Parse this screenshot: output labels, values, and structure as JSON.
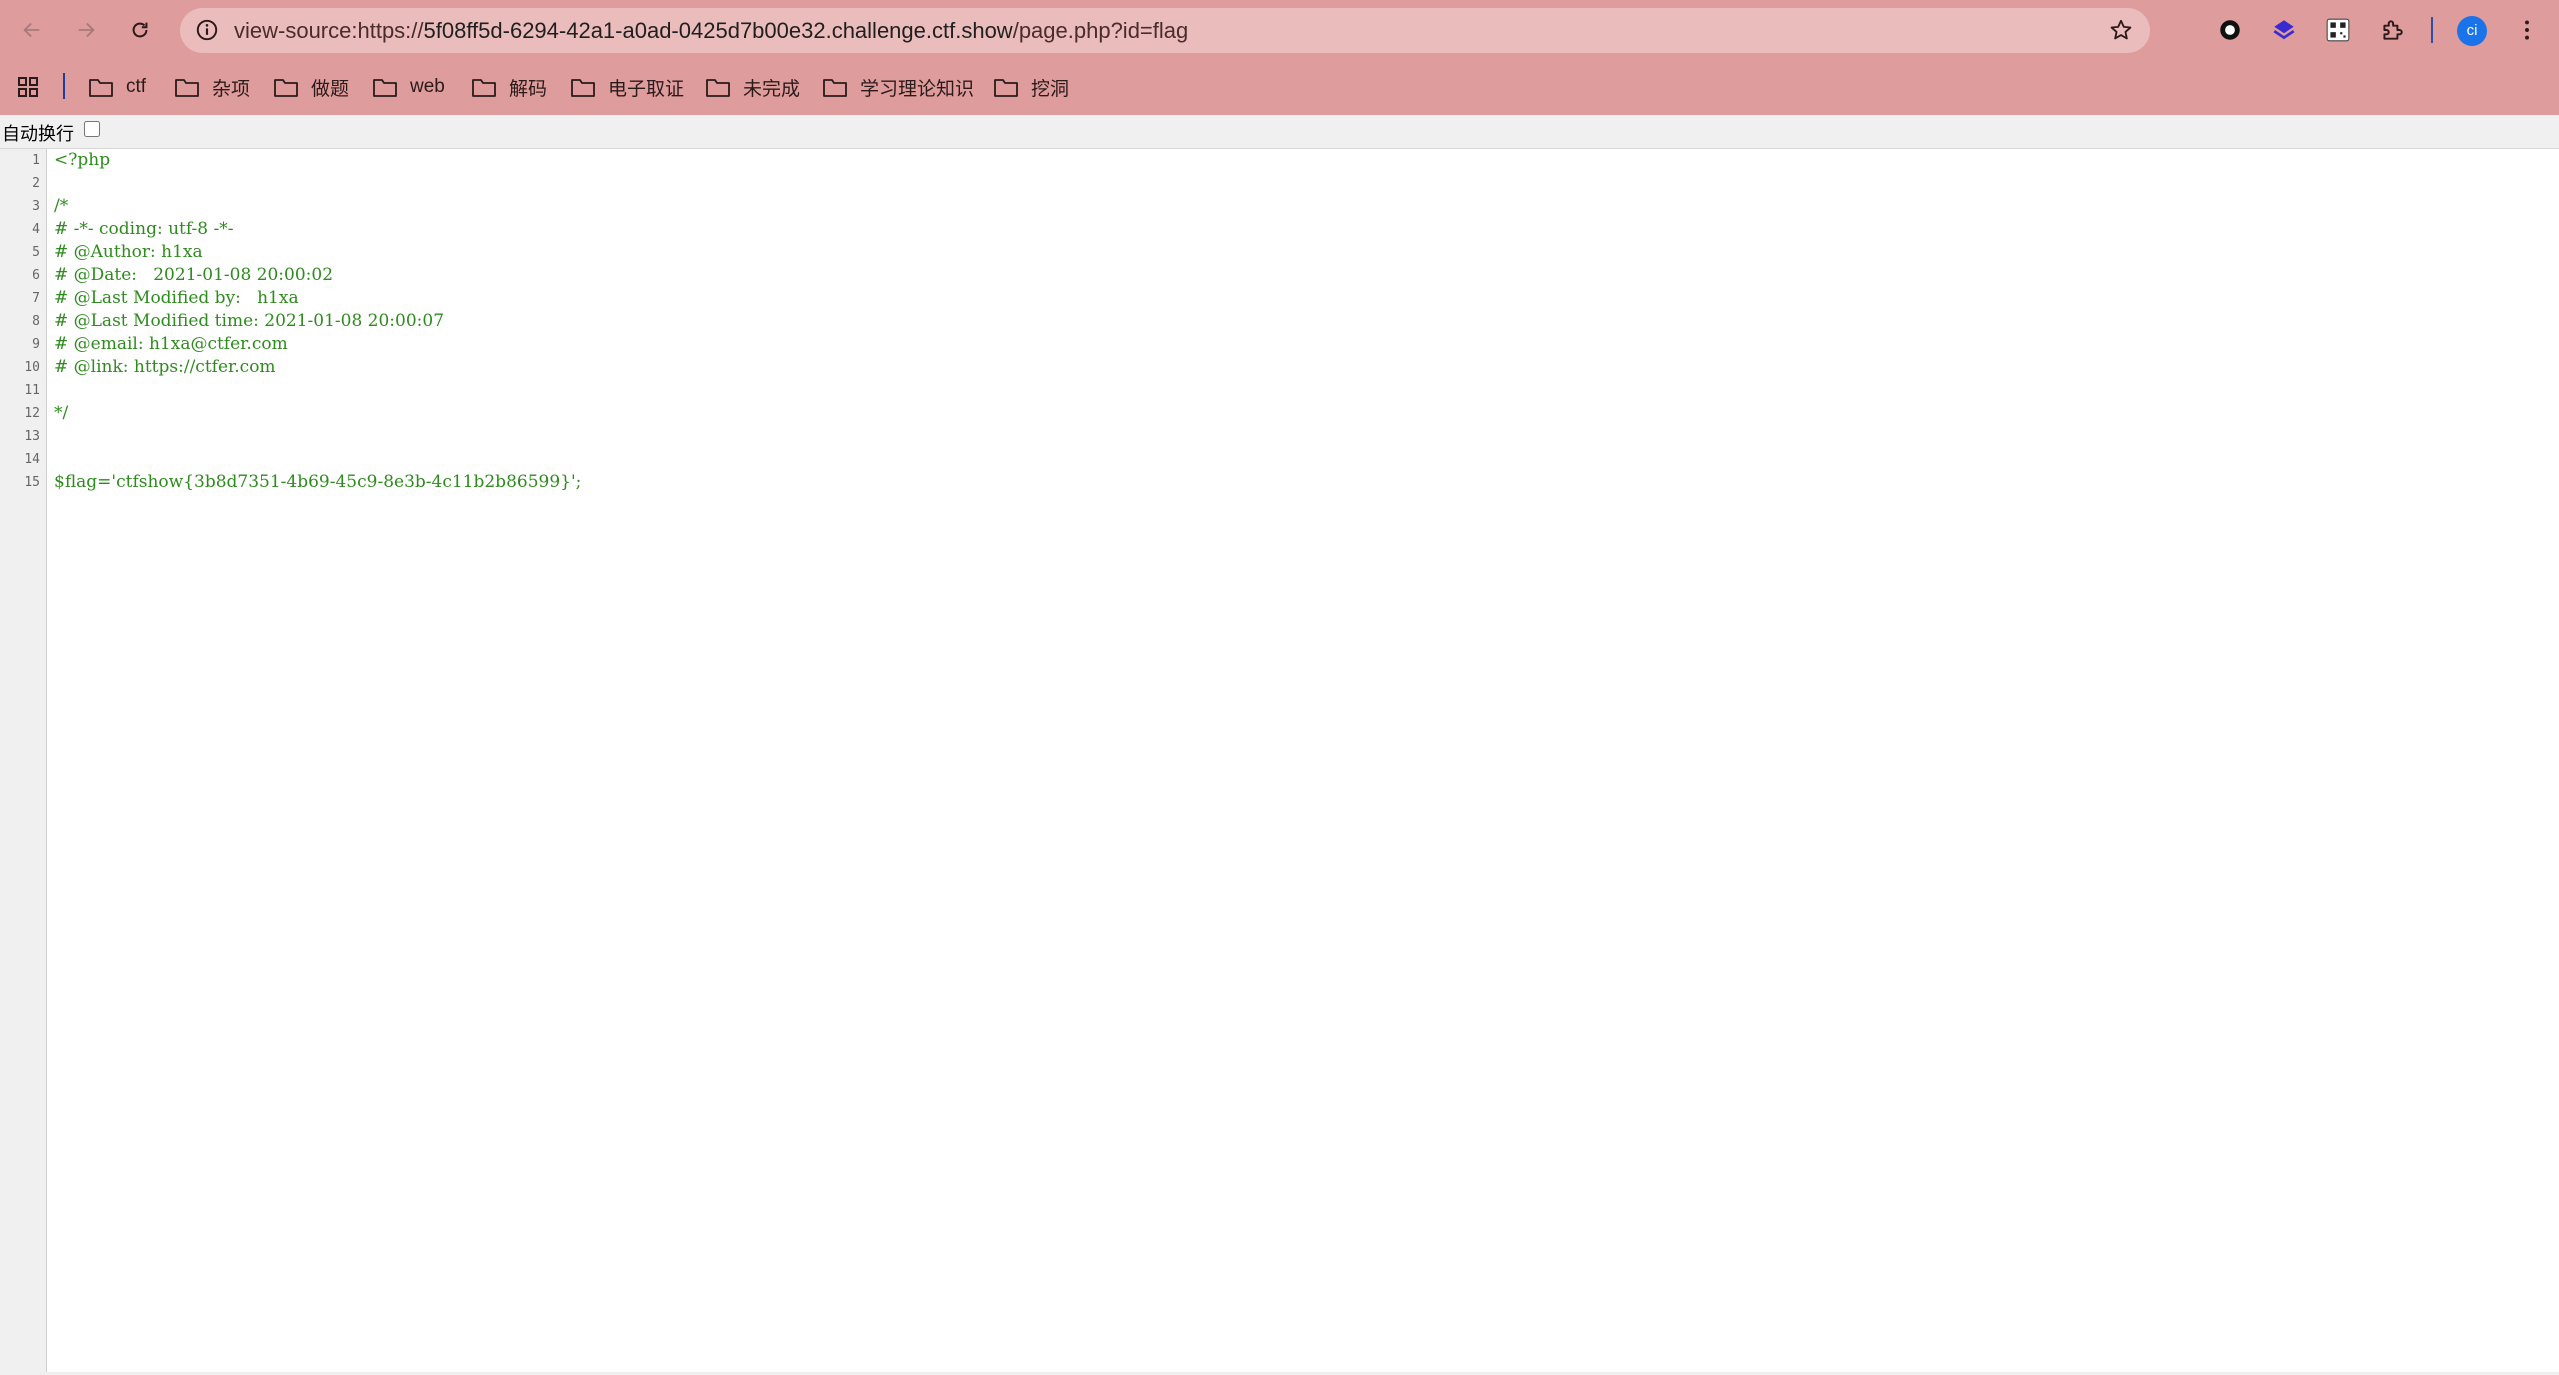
{
  "browser": {
    "url_scheme": "view-source:https://",
    "url_host": "5f08ff5d-6294-42a1-a0ad-0425d7b00e32.challenge.ctf.show",
    "url_path": "/page.php?id=flag",
    "avatar_initials": "ci",
    "topbar_color": "#df9c9c",
    "omnibox_color": "#ebbcbc",
    "icons": [
      "back-arrow-icon",
      "forward-arrow-icon",
      "reload-icon",
      "site-info-icon",
      "bookmark-star-icon",
      "circle-extension-icon",
      "blue-diamond-extension-icon",
      "qr-extension-icon",
      "puzzle-extensions-icon",
      "more-menu-icon"
    ]
  },
  "bookmarks": [
    {
      "label": "ctf"
    },
    {
      "label": "杂项"
    },
    {
      "label": "做题"
    },
    {
      "label": "web"
    },
    {
      "label": "解码"
    },
    {
      "label": "电子取证"
    },
    {
      "label": "未完成"
    },
    {
      "label": "学习理论知识"
    },
    {
      "label": "挖洞"
    }
  ],
  "source_view": {
    "wrap_label": "自动换行",
    "wrap_checked": false,
    "code_color": "#2e8b1d",
    "lines": [
      {
        "n": "1",
        "text": "<?php"
      },
      {
        "n": "2",
        "text": ""
      },
      {
        "n": "3",
        "text": "/*"
      },
      {
        "n": "4",
        "text": "# -*- coding: utf-8 -*-"
      },
      {
        "n": "5",
        "text": "# @Author: h1xa"
      },
      {
        "n": "6",
        "text": "# @Date:   2021-01-08 20:00:02"
      },
      {
        "n": "7",
        "text": "# @Last Modified by:   h1xa"
      },
      {
        "n": "8",
        "text": "# @Last Modified time: 2021-01-08 20:00:07"
      },
      {
        "n": "9",
        "text": "# @email: h1xa@ctfer.com"
      },
      {
        "n": "10",
        "text": "# @link: https://ctfer.com"
      },
      {
        "n": "11",
        "text": ""
      },
      {
        "n": "12",
        "text": "*/"
      },
      {
        "n": "13",
        "text": ""
      },
      {
        "n": "14",
        "text": ""
      },
      {
        "n": "15",
        "text": "$flag='ctfshow{3b8d7351-4b69-45c9-8e3b-4c11b2b86599}';"
      }
    ]
  }
}
